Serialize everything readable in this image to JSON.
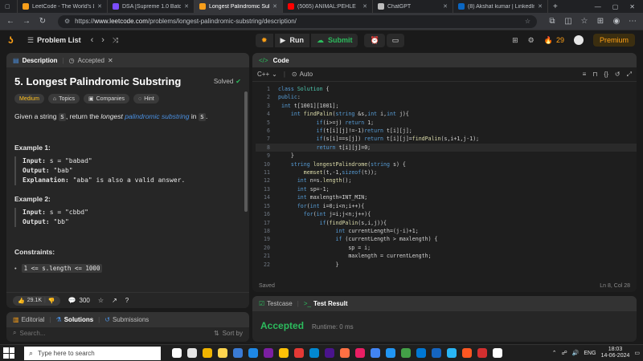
{
  "browser": {
    "tabs": [
      {
        "label": "LeetCode - The World's Le",
        "color": "#f89f1b",
        "active": false
      },
      {
        "label": "DSA [Supreme 1.0 Batch]",
        "color": "#7c4dff",
        "active": false
      },
      {
        "label": "Longest Palindromic Subst",
        "color": "#f89f1b",
        "active": true
      },
      {
        "label": "(5065) ANIMAL:PEHLE",
        "color": "#ff0000",
        "active": false
      },
      {
        "label": "ChatGPT",
        "color": "#bdbdbd",
        "active": false
      },
      {
        "label": "(8) Akshat kumar | LinkedIn",
        "color": "#0a66c2",
        "active": false
      }
    ],
    "url_scheme": "https://",
    "url_host": "www.leetcode.com",
    "url_path": "/problems/longest-palindromic-substring/description/"
  },
  "lc": {
    "problem_list": "Problem List",
    "run": "Run",
    "submit": "Submit",
    "streak": "29",
    "premium": "Premium"
  },
  "description": {
    "tab_description": "Description",
    "tab_accepted": "Accepted",
    "title": "5. Longest Palindromic Substring",
    "solved": "Solved",
    "difficulty": "Medium",
    "tags": [
      "Topics",
      "Companies",
      "Hint"
    ],
    "statement_a": "Given a string ",
    "statement_s": "s",
    "statement_b": ", return the ",
    "statement_c": "longest",
    "statement_d": " palindromic substring",
    "statement_e": " in ",
    "statement_f": "s",
    "statement_g": ".",
    "ex1_title": "Example 1:",
    "ex1_input_label": "Input:",
    "ex1_input": " s = \"babad\"",
    "ex1_output_label": "Output:",
    "ex1_output": " \"bab\"",
    "ex1_expl_label": "Explanation:",
    "ex1_expl": " \"aba\" is also a valid answer.",
    "ex2_title": "Example 2:",
    "ex2_input_label": "Input:",
    "ex2_input": " s = \"cbbd\"",
    "ex2_output_label": "Output:",
    "ex2_output": " \"bb\"",
    "constraints_title": "Constraints:",
    "constraint1": "1 <= s.length <= 1000",
    "likes": "29.1K",
    "comments": "300"
  },
  "bottom_left": {
    "tab_editorial": "Editorial",
    "tab_solutions": "Solutions",
    "tab_submissions": "Submissions",
    "search_placeholder": "Search...",
    "sort": "Sort by"
  },
  "code": {
    "tab": "Code",
    "language": "C++",
    "mode": "Auto",
    "status": "Saved",
    "cursor": "Ln 8, Col 28",
    "lines": [
      [
        [
          "kw",
          "class "
        ],
        [
          "ty",
          "Solution "
        ],
        [
          "tx",
          "{"
        ]
      ],
      [
        [
          "kw",
          "public"
        ],
        [
          "tx",
          ":"
        ]
      ],
      [
        [
          "tx",
          " "
        ],
        [
          "kw",
          "int "
        ],
        [
          "tx",
          "t[1001][1001];"
        ]
      ],
      [
        [
          "tx",
          "    "
        ],
        [
          "kw",
          "int "
        ],
        [
          "fn",
          "findPalin"
        ],
        [
          "tx",
          "("
        ],
        [
          "kw",
          "string "
        ],
        [
          "tx",
          "&s,"
        ],
        [
          "kw",
          "int "
        ],
        [
          "tx",
          "i,"
        ],
        [
          "kw",
          "int "
        ],
        [
          "tx",
          "j){"
        ]
      ],
      [
        [
          "tx",
          "            "
        ],
        [
          "kw",
          "if"
        ],
        [
          "tx",
          "(i>=j) "
        ],
        [
          "kw",
          "return "
        ],
        [
          "tx",
          "1;"
        ]
      ],
      [
        [
          "tx",
          "            "
        ],
        [
          "kw",
          "if"
        ],
        [
          "tx",
          "(t[i][j]!=-1)"
        ],
        [
          "kw",
          "return "
        ],
        [
          "tx",
          "t[i][j];"
        ]
      ],
      [
        [
          "tx",
          "            "
        ],
        [
          "kw",
          "if"
        ],
        [
          "tx",
          "(s[i]==s[j]) "
        ],
        [
          "kw",
          "return "
        ],
        [
          "tx",
          "t[i][j]="
        ],
        [
          "fn",
          "findPalin"
        ],
        [
          "tx",
          "(s,i+1,j-1);"
        ]
      ],
      [
        [
          "tx",
          "            "
        ],
        [
          "kw",
          "return "
        ],
        [
          "tx",
          "t[i][j]=0;"
        ]
      ],
      [
        [
          "tx",
          "    }"
        ]
      ],
      [
        [
          "tx",
          "    "
        ],
        [
          "kw",
          "string "
        ],
        [
          "fn",
          "longestPalindrome"
        ],
        [
          "tx",
          "("
        ],
        [
          "kw",
          "string "
        ],
        [
          "tx",
          "s) {"
        ]
      ],
      [
        [
          "tx",
          "        "
        ],
        [
          "fn",
          "memset"
        ],
        [
          "tx",
          "(t,-1,"
        ],
        [
          "kw",
          "sizeof"
        ],
        [
          "tx",
          "(t));"
        ]
      ],
      [
        [
          "tx",
          "      "
        ],
        [
          "kw",
          "int "
        ],
        [
          "tx",
          "n=s."
        ],
        [
          "fn",
          "length"
        ],
        [
          "tx",
          "();"
        ]
      ],
      [
        [
          "tx",
          "      "
        ],
        [
          "kw",
          "int "
        ],
        [
          "tx",
          "sp=-1;"
        ]
      ],
      [
        [
          "tx",
          "      "
        ],
        [
          "kw",
          "int "
        ],
        [
          "tx",
          "maxlength=INT_MIN;"
        ]
      ],
      [
        [
          "tx",
          "      "
        ],
        [
          "kw",
          "for"
        ],
        [
          "tx",
          "("
        ],
        [
          "kw",
          "int "
        ],
        [
          "tx",
          "i=0;i<n;i++){"
        ]
      ],
      [
        [
          "tx",
          "        "
        ],
        [
          "kw",
          "for"
        ],
        [
          "tx",
          "("
        ],
        [
          "kw",
          "int "
        ],
        [
          "tx",
          "j=i;j<n;j++){"
        ]
      ],
      [
        [
          "tx",
          "             "
        ],
        [
          "kw",
          "if"
        ],
        [
          "tx",
          "("
        ],
        [
          "fn",
          "findPalin"
        ],
        [
          "tx",
          "(s,i,j)){"
        ]
      ],
      [
        [
          "tx",
          "                  "
        ],
        [
          "kw",
          "int "
        ],
        [
          "tx",
          "currentLength=(j-i)+1;"
        ]
      ],
      [
        [
          "tx",
          "                  "
        ],
        [
          "kw",
          "if "
        ],
        [
          "tx",
          "(currentLength > maxlength) {"
        ]
      ],
      [
        [
          "tx",
          "                      sp = i;"
        ]
      ],
      [
        [
          "tx",
          "                      maxlength = currentLength;"
        ]
      ],
      [
        [
          "tx",
          "                  }"
        ]
      ]
    ]
  },
  "testcase": {
    "tab_testcase": "Testcase",
    "tab_result": "Test Result",
    "accepted": "Accepted",
    "runtime": "Runtime: 0 ms"
  },
  "taskbar": {
    "search_placeholder": "Type here to search",
    "lang": "ENG",
    "time": "18:03",
    "date": "14-06-2024"
  },
  "colors": {
    "accent_orange": "#ffa116",
    "accepted_green": "#2cbb5d",
    "link_blue": "#4a90e2"
  }
}
